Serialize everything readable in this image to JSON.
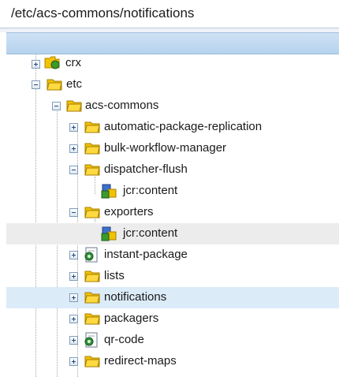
{
  "path_input": {
    "value": "/etc/acs-commons/notifications"
  },
  "tree": {
    "nodes": [
      {
        "label": "crx",
        "icon": "crx-folder-icon",
        "toggle": "expand"
      },
      {
        "label": "etc",
        "icon": "folder-icon",
        "toggle": "collapse"
      },
      {
        "label": "acs-commons",
        "icon": "folder-icon",
        "toggle": "collapse"
      },
      {
        "label": "automatic-package-replication",
        "icon": "folder-icon",
        "toggle": "expand"
      },
      {
        "label": "bulk-workflow-manager",
        "icon": "folder-icon",
        "toggle": "expand"
      },
      {
        "label": "dispatcher-flush",
        "icon": "folder-icon",
        "toggle": "collapse"
      },
      {
        "label": "jcr:content",
        "icon": "content-node-icon",
        "toggle": "none"
      },
      {
        "label": "exporters",
        "icon": "folder-icon",
        "toggle": "collapse"
      },
      {
        "label": "jcr:content",
        "icon": "content-node-icon",
        "toggle": "none",
        "state": "hover"
      },
      {
        "label": "instant-package",
        "icon": "page-node-icon",
        "toggle": "expand"
      },
      {
        "label": "lists",
        "icon": "folder-icon",
        "toggle": "expand"
      },
      {
        "label": "notifications",
        "icon": "folder-icon",
        "toggle": "expand",
        "state": "selected"
      },
      {
        "label": "packagers",
        "icon": "folder-icon",
        "toggle": "expand"
      },
      {
        "label": "qr-code",
        "icon": "page-node-icon",
        "toggle": "expand"
      },
      {
        "label": "redirect-maps",
        "icon": "folder-icon",
        "toggle": "expand"
      }
    ]
  },
  "colors": {
    "folder": "#f2c200",
    "header": "#c2d9f0",
    "selected_row": "#dcebf8",
    "hover_row": "#ececec"
  }
}
